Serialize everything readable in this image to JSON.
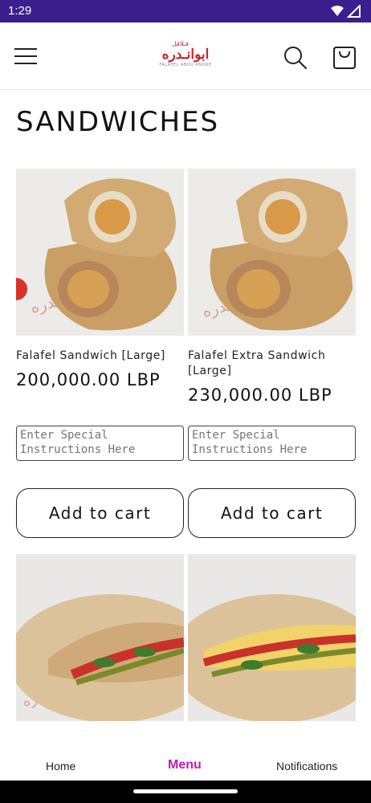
{
  "status": {
    "time": "1:29"
  },
  "header": {
    "logo_arabic": "ابوانـدره",
    "logo_top": "فـلافل",
    "logo_sub": "FALAFEL ABOU ANDRE"
  },
  "page": {
    "title": "SANDWICHES"
  },
  "products": [
    {
      "name": "Falafel Sandwich [Large]",
      "price": "200,000.00 LBP",
      "notes_placeholder": "Enter Special Instructions Here",
      "add_label": "Add to cart"
    },
    {
      "name": "Falafel Extra Sandwich [Large]",
      "price": "230,000.00 LBP",
      "notes_placeholder": "Enter Special Instructions Here",
      "add_label": "Add to cart"
    },
    {
      "name": "",
      "price": ""
    },
    {
      "name": "",
      "price": ""
    }
  ],
  "bottom_nav": {
    "home": "Home",
    "menu": "Menu",
    "notifications": "Notifications"
  },
  "colors": {
    "status_bar": "#3b1f8f",
    "accent": "#c01ab8",
    "logo_red": "#c9252c"
  },
  "icons": [
    "menu-icon",
    "search-icon",
    "cart-icon",
    "wifi-icon",
    "signal-icon"
  ]
}
